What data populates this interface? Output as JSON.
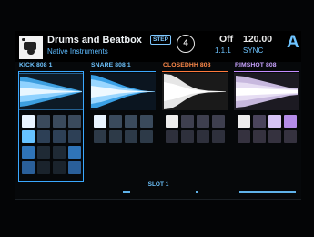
{
  "header": {
    "kit_name": "Drums and Beatbox",
    "mode_badge": "STEP",
    "vendor": "Native Instruments",
    "group_number": "4",
    "state": "Off",
    "tempo": "120.00",
    "position": "1.1.1",
    "sync": "SYNC",
    "group_letter": "A"
  },
  "sounds": [
    {
      "name": "KICK 808 1",
      "accent": "#3aa8ff",
      "label_color": "#6ec4ff",
      "icon": "kick-waveform"
    },
    {
      "name": "SNARE 808 1",
      "accent": "#3aa8ff",
      "label_color": "#6ec4ff",
      "icon": "snare-waveform"
    },
    {
      "name": "CLOSEDHH 808",
      "accent": "#ff7a3c",
      "label_color": "#ff8a4a",
      "icon": "closedhh-waveform"
    },
    {
      "name": "RIMSHOT 808",
      "accent": "#c48cff",
      "label_color": "#c9a3ff",
      "icon": "rimshot-waveform"
    }
  ],
  "slot": {
    "label": "SLOT 1"
  }
}
